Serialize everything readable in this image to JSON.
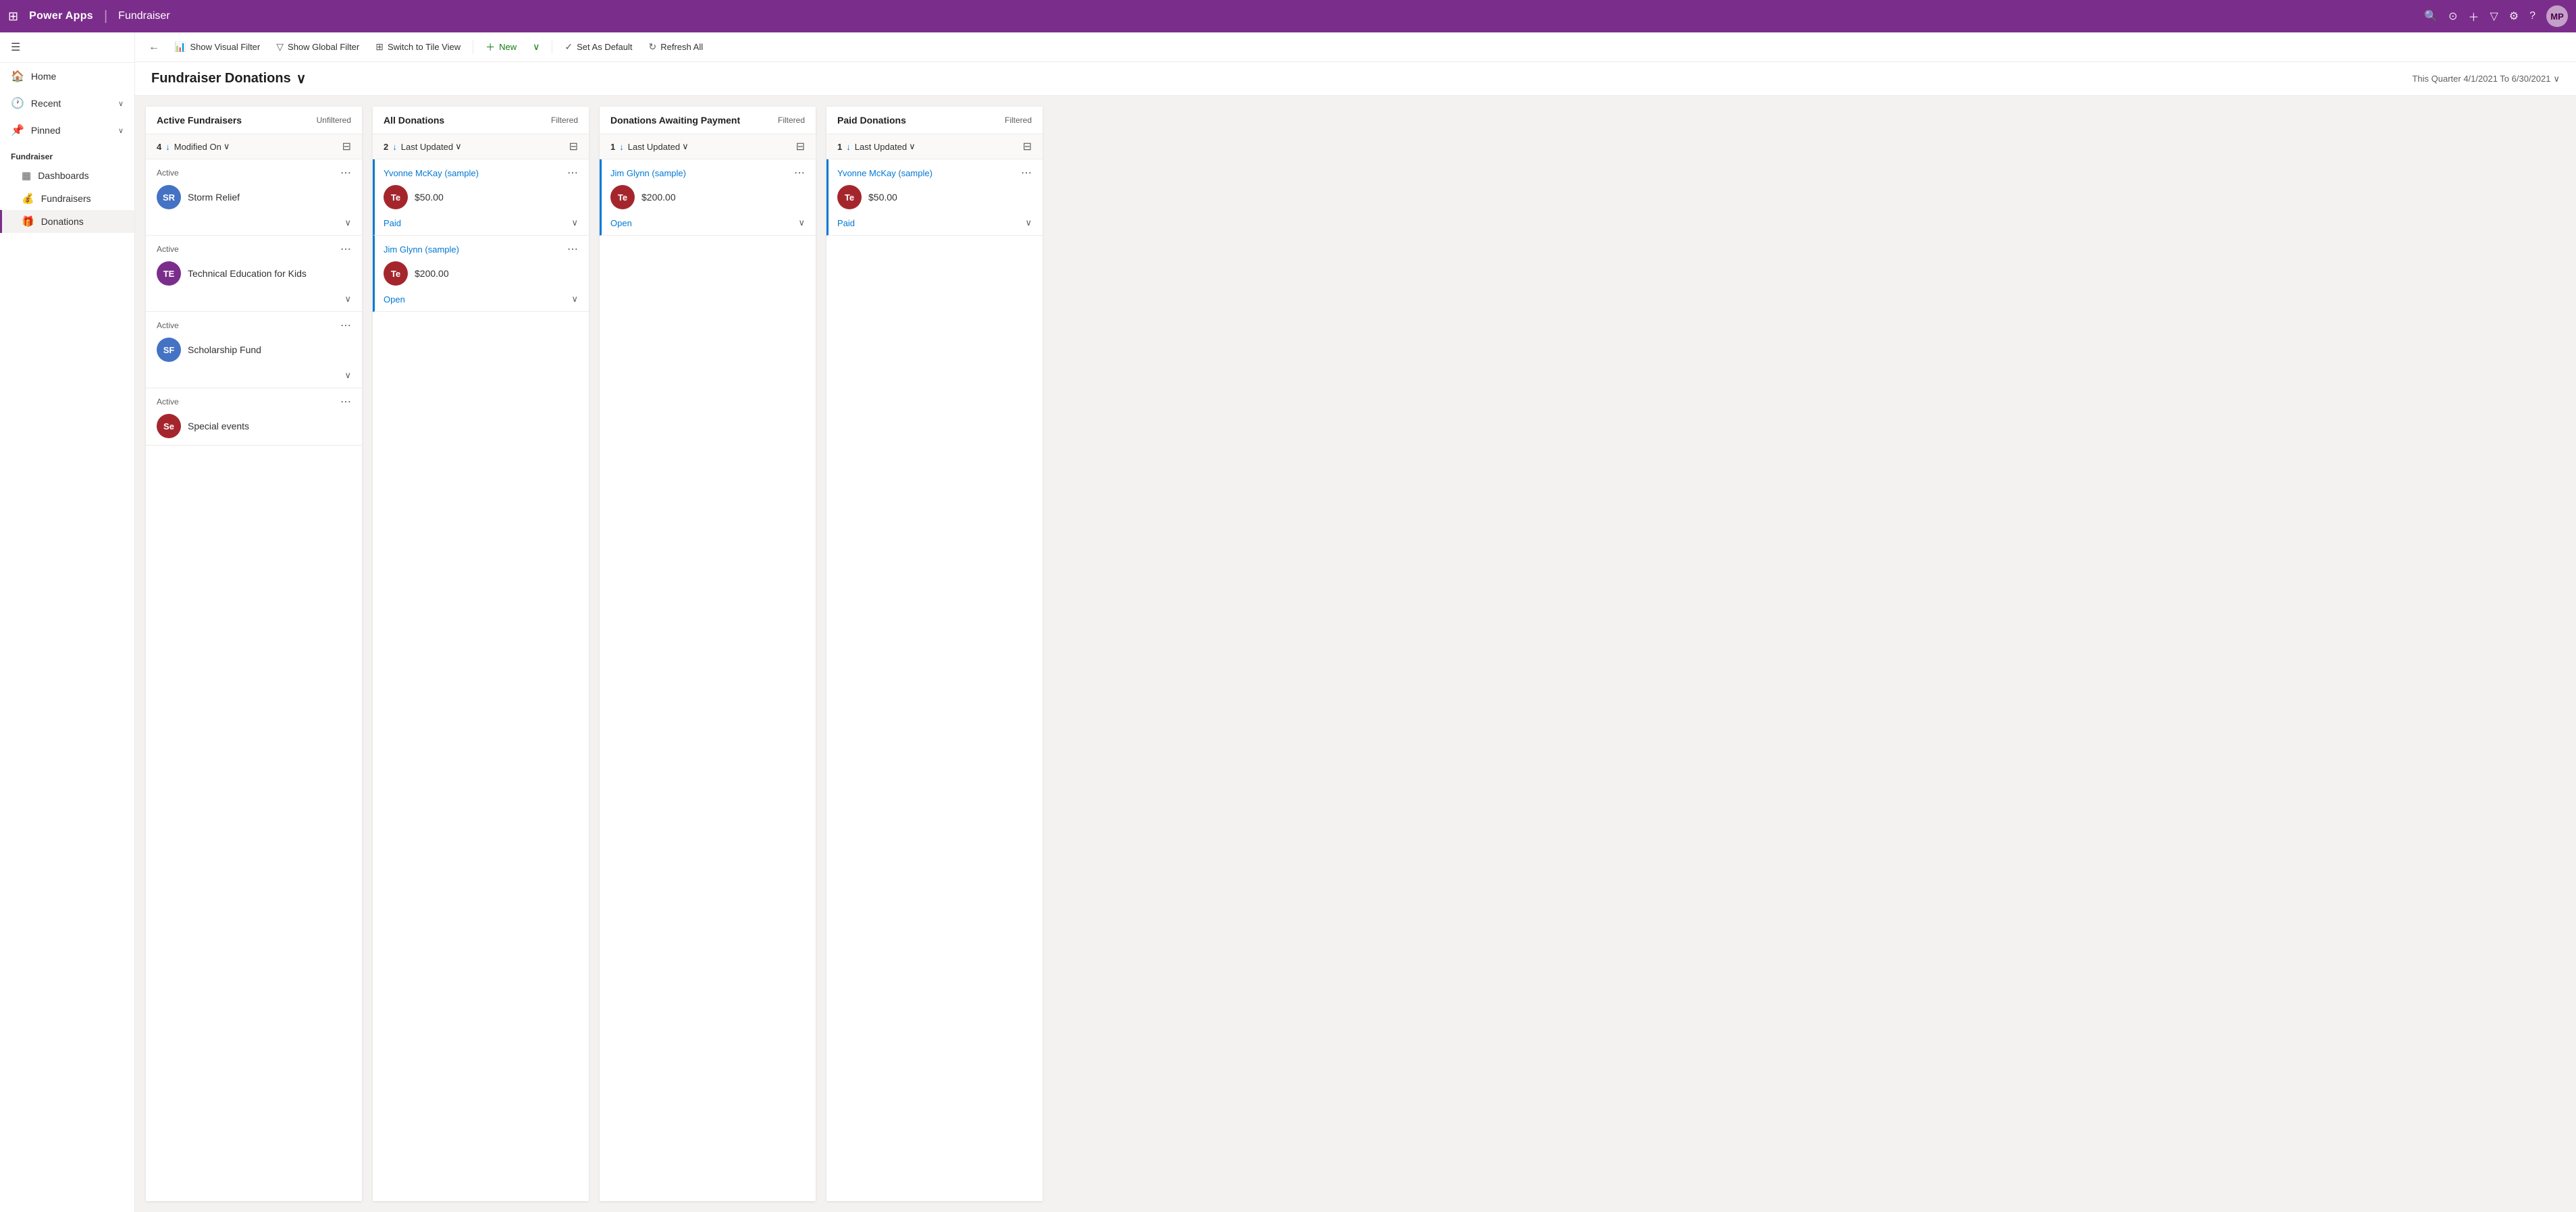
{
  "topbar": {
    "waffle": "⊞",
    "app_name": "Power Apps",
    "divider": "|",
    "page_name": "Fundraiser",
    "icons": [
      "🔍",
      "⊙",
      "+",
      "▽",
      "⚙",
      "?"
    ],
    "avatar_initials": "MP",
    "avatar_bg": "#c4a0c8"
  },
  "sidebar": {
    "hamburger": "☰",
    "nav_items": [
      {
        "id": "home",
        "icon": "🏠",
        "label": "Home",
        "has_chevron": false
      },
      {
        "id": "recent",
        "icon": "🕐",
        "label": "Recent",
        "has_chevron": true
      },
      {
        "id": "pinned",
        "icon": "📌",
        "label": "Pinned",
        "has_chevron": true
      }
    ],
    "section_label": "Fundraiser",
    "sub_items": [
      {
        "id": "dashboards",
        "icon": "▦",
        "label": "Dashboards",
        "active": false
      },
      {
        "id": "fundraisers",
        "icon": "💰",
        "label": "Fundraisers",
        "active": false
      },
      {
        "id": "donations",
        "icon": "🎁",
        "label": "Donations",
        "active": true
      }
    ]
  },
  "toolbar": {
    "back_icon": "←",
    "buttons": [
      {
        "id": "show-visual-filter",
        "icon": "📊",
        "label": "Show Visual Filter"
      },
      {
        "id": "show-global-filter",
        "icon": "▽",
        "label": "Show Global Filter"
      },
      {
        "id": "switch-tile-view",
        "icon": "⊞",
        "label": "Switch to Tile View"
      },
      {
        "id": "new",
        "icon": "+",
        "label": "New",
        "type": "new"
      },
      {
        "id": "new-chevron",
        "icon": "∨",
        "label": "",
        "type": "new"
      },
      {
        "id": "set-default",
        "icon": "✓",
        "label": "Set As Default"
      },
      {
        "id": "refresh-all",
        "icon": "↻",
        "label": "Refresh All"
      }
    ]
  },
  "view": {
    "title": "Fundraiser Donations",
    "title_chevron": "∨",
    "date_range": "This Quarter 4/1/2021 To 6/30/2021",
    "date_chevron": "∨"
  },
  "columns": [
    {
      "id": "active-fundraisers",
      "title": "Active Fundraisers",
      "filter_label": "Unfiltered",
      "count": 4,
      "sort_field": "Modified On",
      "sort_direction": "↓",
      "cards": [
        {
          "id": "storm-relief",
          "status": "Active",
          "avatar_initials": "SR",
          "avatar_bg": "#4472C4",
          "name": "Storm Relief",
          "show_chevron": true
        },
        {
          "id": "technical-education",
          "status": "Active",
          "avatar_initials": "TE",
          "avatar_bg": "#7B2D8B",
          "name": "Technical Education for Kids",
          "show_chevron": true
        },
        {
          "id": "scholarship-fund",
          "status": "Active",
          "avatar_initials": "SF",
          "avatar_bg": "#4472C4",
          "name": "Scholarship Fund",
          "show_chevron": true
        },
        {
          "id": "special-events",
          "status": "Active",
          "avatar_initials": "Se",
          "avatar_bg": "#A4262C",
          "name": "Special events",
          "show_chevron": false
        }
      ]
    },
    {
      "id": "all-donations",
      "title": "All Donations",
      "filter_label": "Filtered",
      "count": 2,
      "sort_field": "Last Updated",
      "sort_direction": "↓",
      "cards": [
        {
          "id": "yvonne-mckay-donation",
          "type": "donation",
          "donor": "Yvonne McKay (sample)",
          "avatar_initials": "Te",
          "avatar_bg": "#A4262C",
          "amount": "$50.00",
          "status": "Paid",
          "show_chevron": true,
          "blue_bar": true
        },
        {
          "id": "jim-glynn-donation",
          "type": "donation",
          "donor": "Jim Glynn (sample)",
          "avatar_initials": "Te",
          "avatar_bg": "#A4262C",
          "amount": "$200.00",
          "status": "Open",
          "show_chevron": true,
          "blue_bar": true
        }
      ]
    },
    {
      "id": "donations-awaiting-payment",
      "title": "Donations Awaiting Payment",
      "filter_label": "Filtered",
      "count": 1,
      "sort_field": "Last Updated",
      "sort_direction": "↓",
      "cards": [
        {
          "id": "jim-glynn-awaiting",
          "type": "donation",
          "donor": "Jim Glynn (sample)",
          "avatar_initials": "Te",
          "avatar_bg": "#A4262C",
          "amount": "$200.00",
          "status": "Open",
          "show_chevron": true,
          "blue_bar": true
        }
      ]
    },
    {
      "id": "paid-donations",
      "title": "Paid Donations",
      "filter_label": "Filtered",
      "count": 1,
      "sort_field": "Last Updated",
      "sort_direction": "↓",
      "cards": [
        {
          "id": "yvonne-mckay-paid",
          "type": "donation",
          "donor": "Yvonne McKay (sample)",
          "avatar_initials": "Te",
          "avatar_bg": "#A4262C",
          "amount": "$50.00",
          "status": "Paid",
          "show_chevron": true,
          "blue_bar": true
        }
      ]
    }
  ]
}
